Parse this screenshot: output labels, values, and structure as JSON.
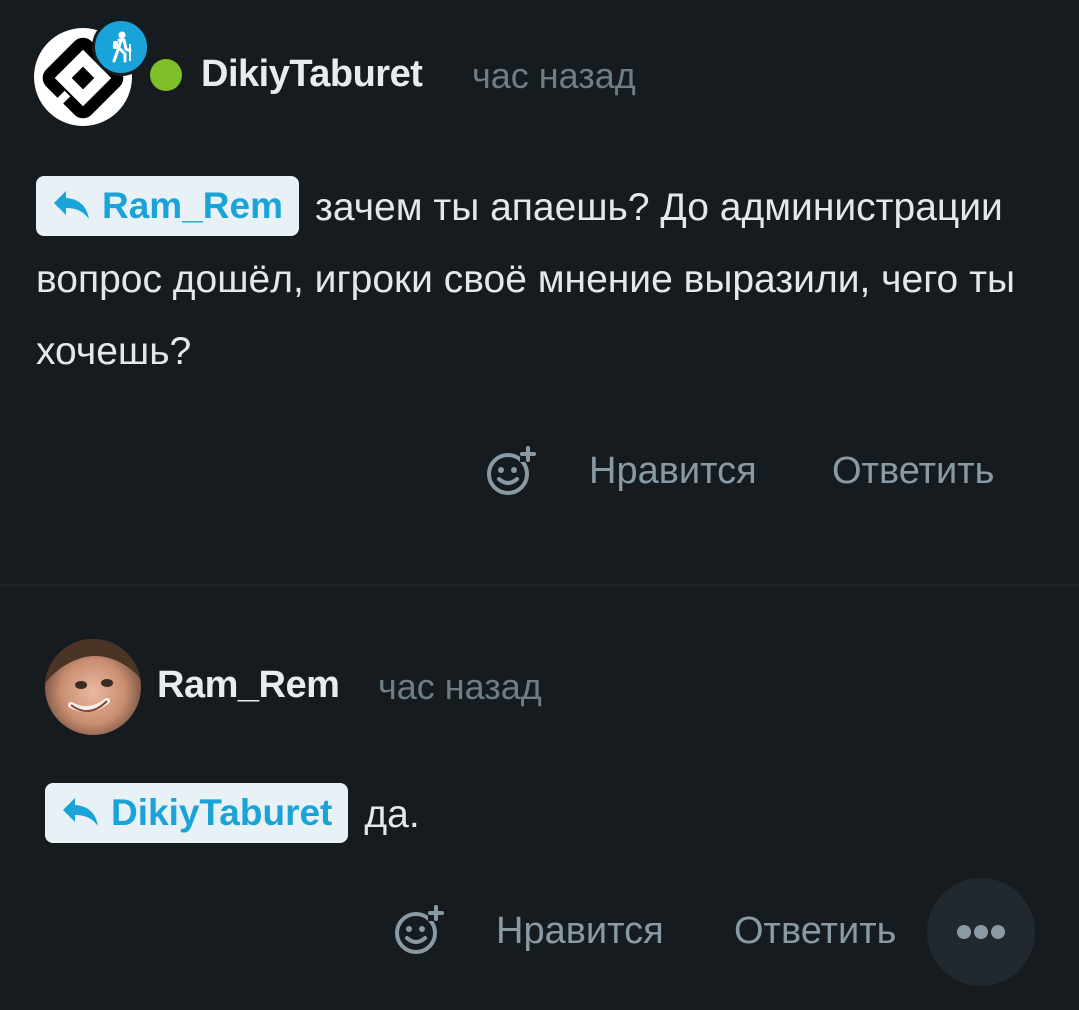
{
  "comments": [
    {
      "author": "DikiyTaburet",
      "time": "час назад",
      "online": true,
      "avatar": "hexagon-logo-avatar",
      "badge_icon": "hiker-icon",
      "reply_to": "Ram_Rem",
      "text": "зачем ты апаешь? До администрации вопрос дошёл, игроки своё мнение выразили, чего ты хочешь?",
      "like_label": "Нравится",
      "reply_label": "Ответить"
    },
    {
      "author": "Ram_Rem",
      "time": "час назад",
      "avatar": "photo-avatar",
      "reply_to": "DikiyTaburet",
      "text": "да.",
      "like_label": "Нравится",
      "reply_label": "Ответить",
      "more_icon": "more-dots-icon"
    }
  ],
  "colors": {
    "background": "#161b1f",
    "accent": "#1aa3d9",
    "online": "#7fbf2a",
    "muted": "#6f7d86"
  }
}
